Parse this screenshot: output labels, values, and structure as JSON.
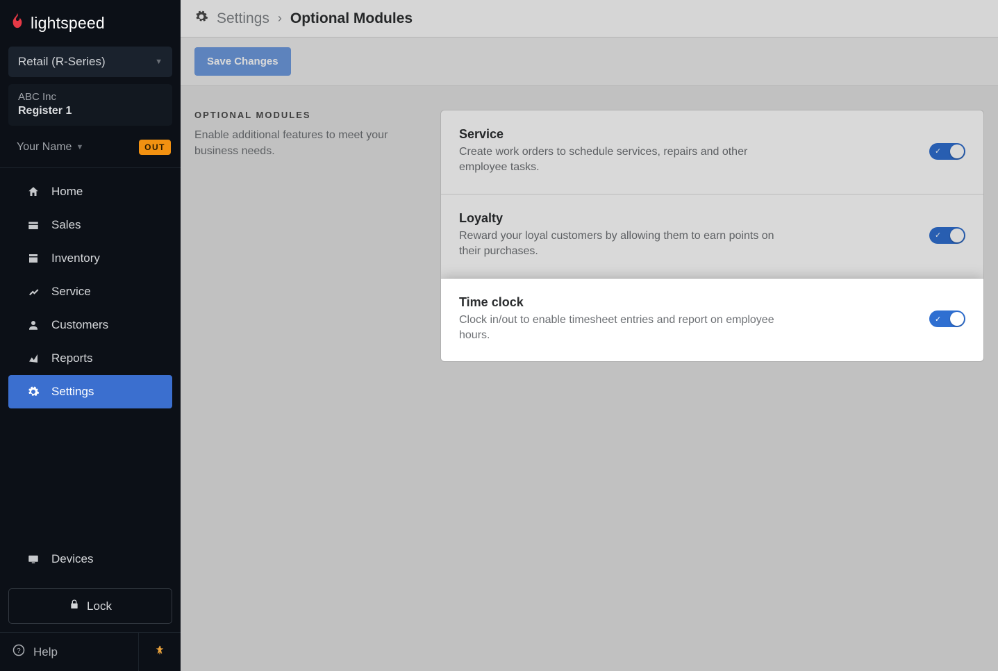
{
  "brand": "lightspeed",
  "product_selector": "Retail (R-Series)",
  "account": {
    "company": "ABC Inc",
    "register": "Register 1"
  },
  "user": {
    "name": "Your Name",
    "status_badge": "OUT"
  },
  "nav": {
    "home": "Home",
    "sales": "Sales",
    "inventory": "Inventory",
    "service": "Service",
    "customers": "Customers",
    "reports": "Reports",
    "settings": "Settings",
    "devices": "Devices"
  },
  "lock_label": "Lock",
  "help_label": "Help",
  "breadcrumb": {
    "parent": "Settings",
    "current": "Optional Modules"
  },
  "save_label": "Save Changes",
  "section": {
    "heading": "OPTIONAL MODULES",
    "description": "Enable additional features to meet your business needs."
  },
  "modules": [
    {
      "title": "Service",
      "desc": "Create work orders to schedule services, repairs and other employee tasks.",
      "enabled": true
    },
    {
      "title": "Loyalty",
      "desc": "Reward your loyal customers by allowing them to earn points on their purchases.",
      "enabled": true
    },
    {
      "title": "Time clock",
      "desc": "Clock in/out to enable timesheet entries and report on employee hours.",
      "enabled": true
    }
  ]
}
